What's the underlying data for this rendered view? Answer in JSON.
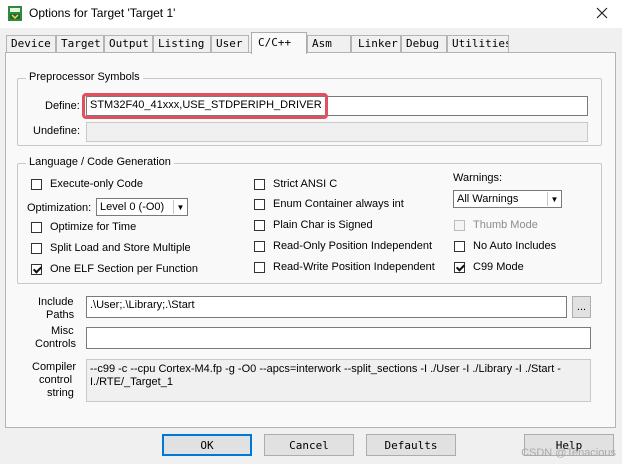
{
  "window": {
    "title": "Options for Target 'Target 1'"
  },
  "tabs": [
    {
      "label": "Device"
    },
    {
      "label": "Target"
    },
    {
      "label": "Output"
    },
    {
      "label": "Listing"
    },
    {
      "label": "User"
    },
    {
      "label": "C/C++"
    },
    {
      "label": "Asm"
    },
    {
      "label": "Linker"
    },
    {
      "label": "Debug"
    },
    {
      "label": "Utilities"
    }
  ],
  "active_tab": "C/C++",
  "preprocessor": {
    "title": "Preprocessor Symbols",
    "define_label": "Define:",
    "define_value": "STM32F40_41xxx,USE_STDPERIPH_DRIVER",
    "undefine_label": "Undefine:",
    "undefine_value": ""
  },
  "language": {
    "title": "Language / Code Generation",
    "execute_only": {
      "label": "Execute-only Code",
      "checked": false
    },
    "optimization_label": "Optimization:",
    "optimization_value": "Level 0 (-O0)",
    "optimize_time": {
      "label": "Optimize for Time",
      "checked": false
    },
    "split_load": {
      "label": "Split Load and Store Multiple",
      "checked": false
    },
    "one_elf": {
      "label": "One ELF Section per Function",
      "checked": true
    },
    "strict_ansi": {
      "label": "Strict ANSI C",
      "checked": false
    },
    "enum_container": {
      "label": "Enum Container always int",
      "checked": false
    },
    "plain_char": {
      "label": "Plain Char is Signed",
      "checked": false
    },
    "ro_pos_indep": {
      "label": "Read-Only Position Independent",
      "checked": false
    },
    "rw_pos_indep": {
      "label": "Read-Write Position Independent",
      "checked": false
    },
    "warnings_label": "Warnings:",
    "warnings_value": "All Warnings",
    "thumb_mode": {
      "label": "Thumb Mode",
      "checked": false,
      "disabled": true
    },
    "no_auto_includes": {
      "label": "No Auto Includes",
      "checked": false
    },
    "c99_mode": {
      "label": "C99 Mode",
      "checked": true
    }
  },
  "paths": {
    "include_label_1": "Include",
    "include_label_2": "Paths",
    "include_value": ".\\User;.\\Library;.\\Start",
    "browse_label": "...",
    "misc_label_1": "Misc",
    "misc_label_2": "Controls",
    "misc_value": "",
    "compiler_label_1": "Compiler",
    "compiler_label_2": "control",
    "compiler_label_3": "string",
    "compiler_value": "--c99 -c --cpu Cortex-M4.fp -g -O0 --apcs=interwork --split_sections -I ./User -I ./Library -I ./Start -I./RTE/_Target_1"
  },
  "buttons": {
    "ok": "OK",
    "cancel": "Cancel",
    "defaults": "Defaults",
    "help": "Help"
  },
  "watermark": "CSDN @Tenacious"
}
